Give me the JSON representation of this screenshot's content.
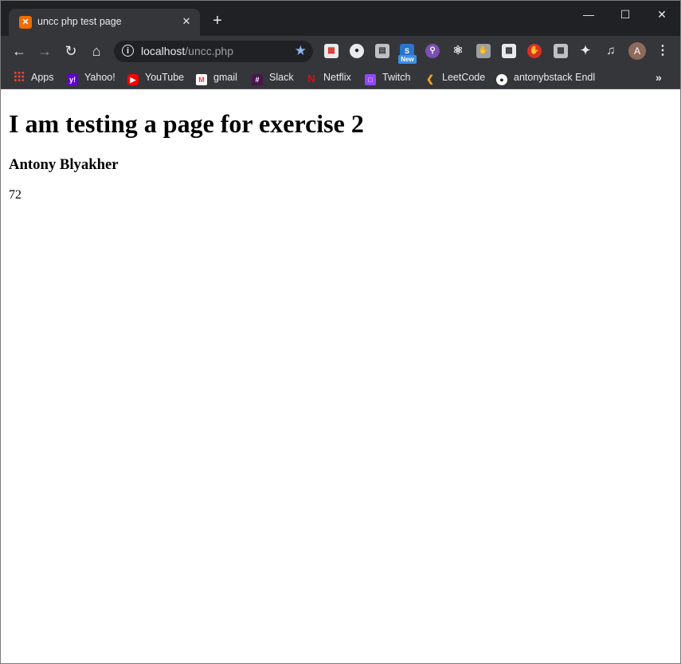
{
  "tab": {
    "title": "uncc php test page",
    "favicon": "xampp-icon"
  },
  "omnibox": {
    "host": "localhost",
    "path": "/uncc.php"
  },
  "extensions": {
    "new_badge": "New"
  },
  "profile": {
    "initial": "A"
  },
  "bookmarks": [
    {
      "label": "Apps",
      "icon": "apps-grid-icon"
    },
    {
      "label": "Yahoo!",
      "icon": "yahoo-icon"
    },
    {
      "label": "YouTube",
      "icon": "youtube-icon"
    },
    {
      "label": "gmail",
      "icon": "gmail-icon"
    },
    {
      "label": "Slack",
      "icon": "slack-icon"
    },
    {
      "label": "Netflix",
      "icon": "netflix-icon"
    },
    {
      "label": "Twitch",
      "icon": "twitch-icon"
    },
    {
      "label": "LeetCode",
      "icon": "leetcode-icon"
    },
    {
      "label": "antonybstack Endl",
      "icon": "github-icon"
    }
  ],
  "page": {
    "heading": "I am testing a page for exercise 2",
    "subheading": "Antony Blyakher",
    "value": "72"
  },
  "colors": {
    "titlebar": "#202124",
    "toolbar": "#35363a",
    "accent_star": "#8ab4f8"
  }
}
